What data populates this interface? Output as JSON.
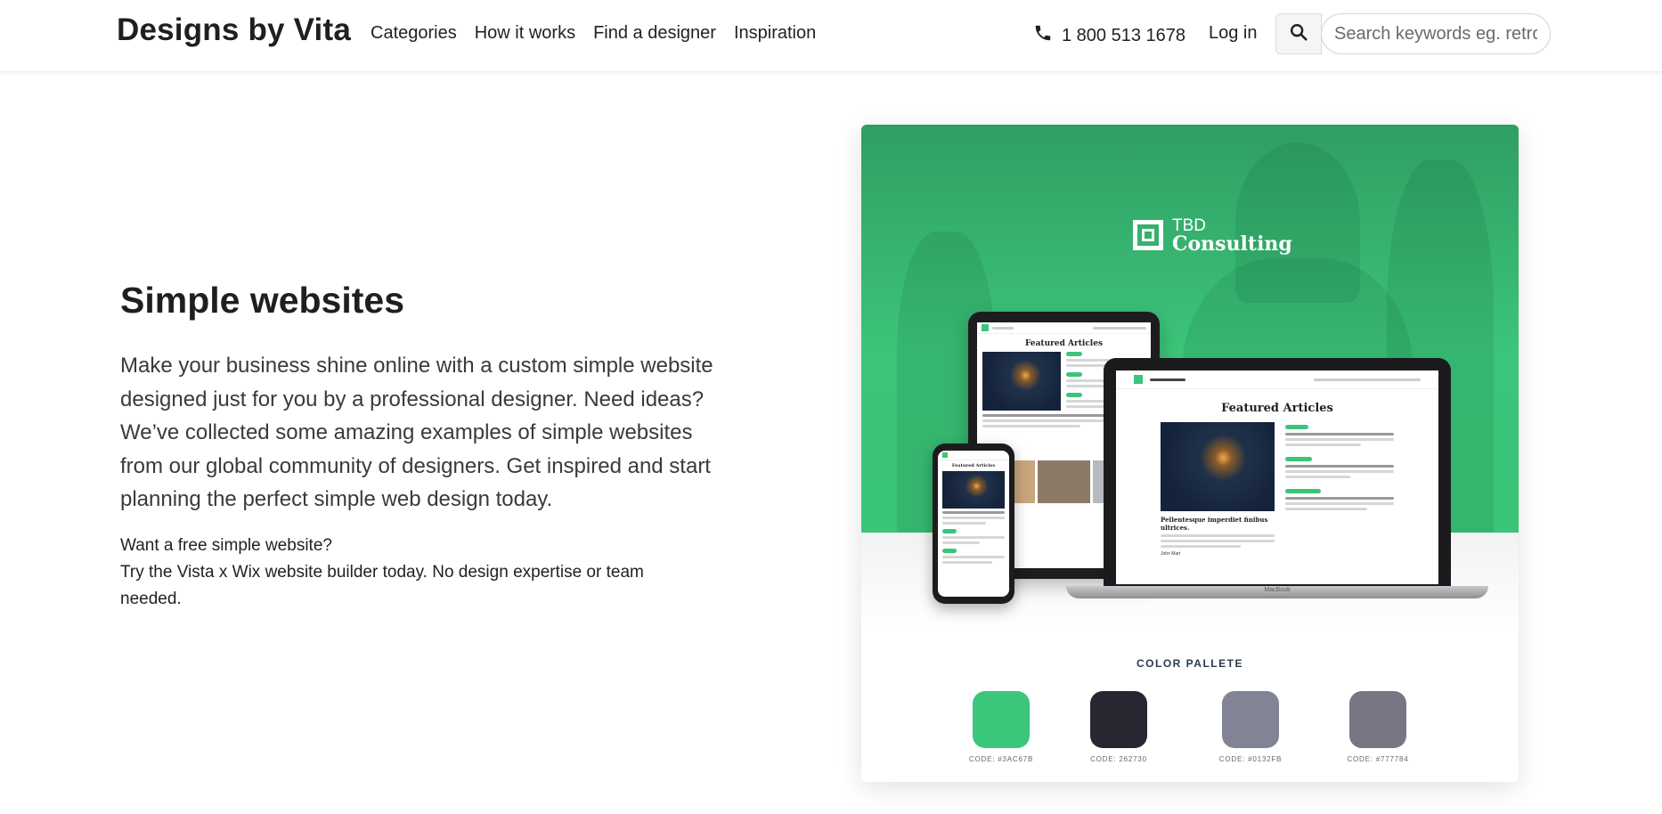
{
  "header": {
    "logo": "Designs by Vita",
    "nav": [
      "Categories",
      "How it works",
      "Find a designer",
      "Inspiration"
    ],
    "phone": "1 800 513 1678",
    "login": "Log in",
    "search_placeholder": "Search keywords eg. retro"
  },
  "hero": {
    "title": "Simple websites",
    "description": "Make your business shine online with a custom simple website designed just for you by a professional designer. Need ideas? We’ve collected some amazing examples of simple websites from our global community of designers. Get inspired and start planning the perfect simple web design today.",
    "note_line1": "Want a free simple website?",
    "note_line2": "Try the Vista x Wix website builder today. No design expertise or team needed."
  },
  "showcase": {
    "brand_line1": "TBD",
    "brand_line2": "Consulting",
    "featured_title": "Featured Articles",
    "article_title": "Pellentesque imperdiet finibus ultrices.",
    "author": "John Mart",
    "laptop_label": "MacBook",
    "palette_title": "COLOR PALLETE",
    "swatches": [
      {
        "code": "CODE: #3AC67B",
        "color": "#3ac67b"
      },
      {
        "code": "CODE: 262730",
        "color": "#262730"
      },
      {
        "code": "CODE: #0132FB",
        "color": "#828395"
      },
      {
        "code": "CODE: #777784",
        "color": "#777784"
      }
    ]
  }
}
